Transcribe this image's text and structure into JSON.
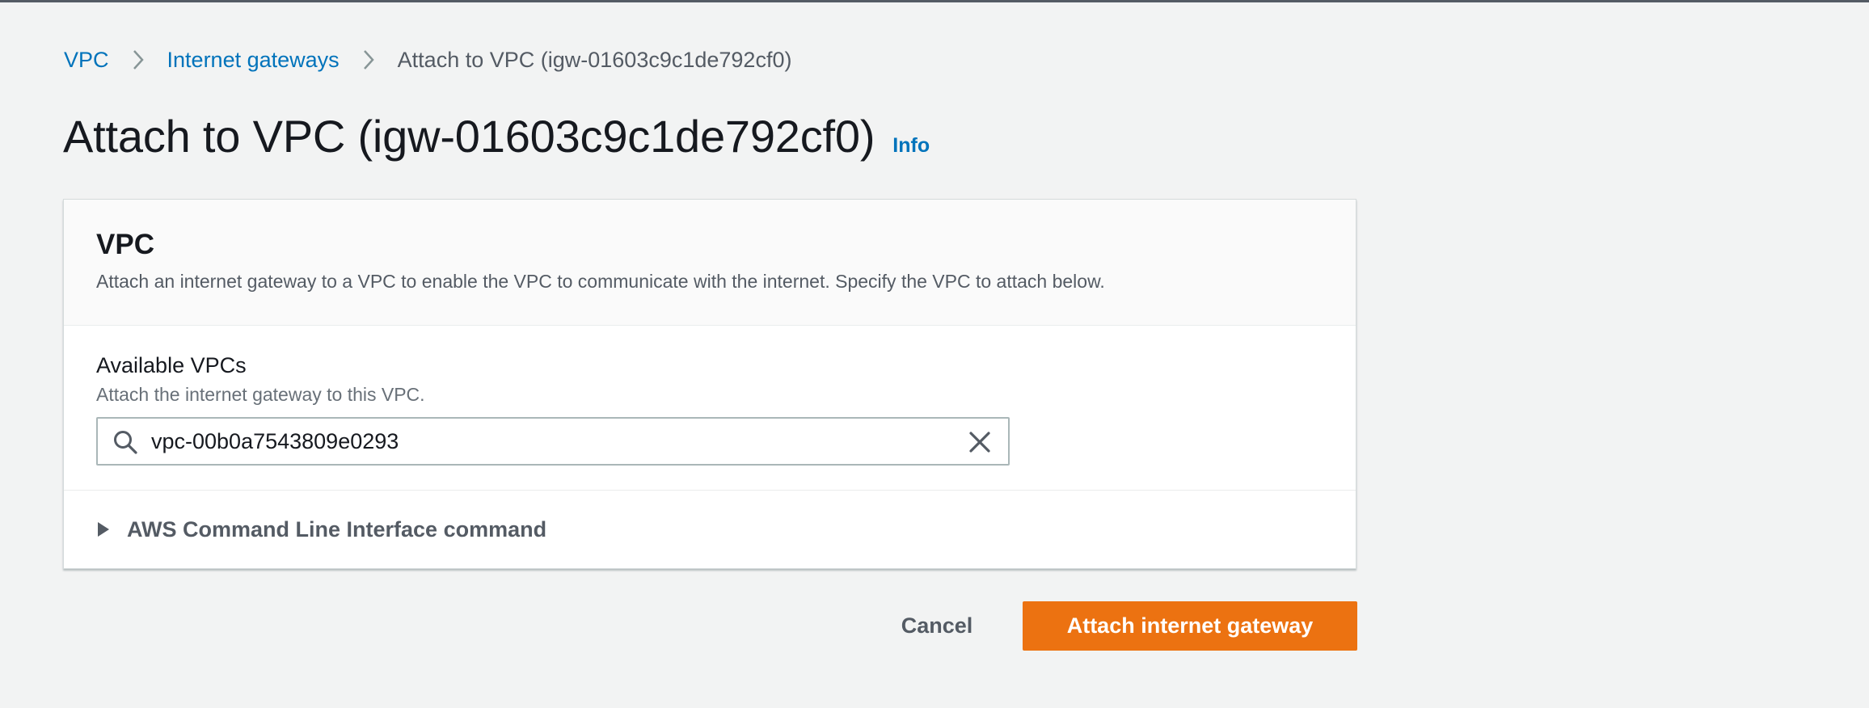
{
  "breadcrumb": {
    "items": [
      {
        "label": "VPC",
        "link": true
      },
      {
        "label": "Internet gateways",
        "link": true
      },
      {
        "label": "Attach to VPC (igw-01603c9c1de792cf0)",
        "link": false
      }
    ]
  },
  "header": {
    "title": "Attach to VPC (igw-01603c9c1de792cf0)",
    "info_label": "Info"
  },
  "panel": {
    "title": "VPC",
    "description": "Attach an internet gateway to a VPC to enable the VPC to communicate with the internet. Specify the VPC to attach below.",
    "field": {
      "label": "Available VPCs",
      "description": "Attach the internet gateway to this VPC.",
      "value": "vpc-00b0a7543809e0293"
    },
    "expander_label": "AWS Command Line Interface command"
  },
  "actions": {
    "cancel_label": "Cancel",
    "submit_label": "Attach internet gateway"
  },
  "colors": {
    "link": "#0073bb",
    "primary": "#ec7211",
    "background": "#f2f3f3"
  },
  "icons": [
    "chevron-right-icon",
    "search-icon",
    "clear-icon",
    "caret-right-icon"
  ]
}
